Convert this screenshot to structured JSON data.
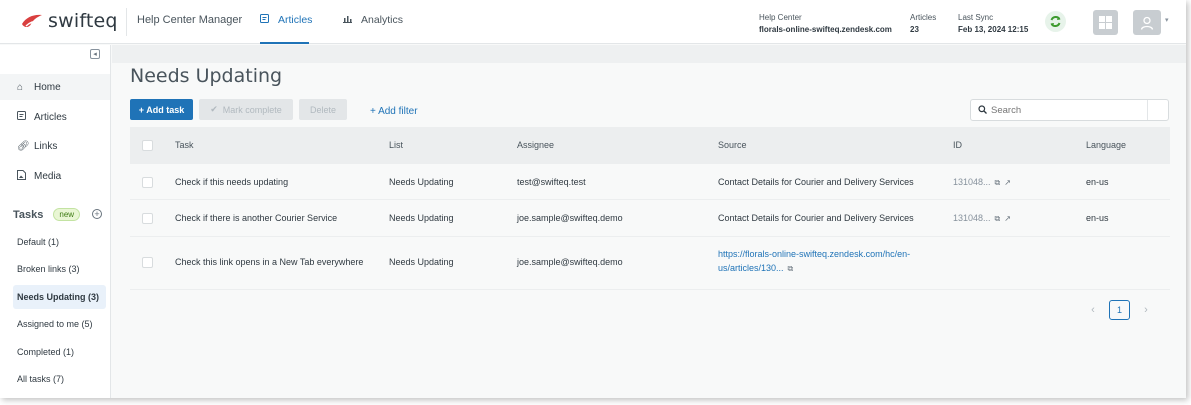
{
  "brand": {
    "name": "swifteq",
    "accent": "#1f73b7",
    "logo_color": "#d93f3f"
  },
  "header": {
    "app_title": "Help Center Manager",
    "tabs": [
      {
        "label": "Articles",
        "icon": "articles-icon",
        "active": true
      },
      {
        "label": "Analytics",
        "icon": "analytics-icon",
        "active": false
      }
    ],
    "help_center": {
      "label": "Help Center",
      "value": "florals-online-swifteq.zendesk.com"
    },
    "articles": {
      "label": "Articles",
      "value": "23"
    },
    "last_sync": {
      "label": "Last Sync",
      "value": "Feb 13, 2024 12:15"
    }
  },
  "sidebar": {
    "items": [
      {
        "label": "Home",
        "icon": "home-icon"
      },
      {
        "label": "Articles",
        "icon": "article-icon"
      },
      {
        "label": "Links",
        "icon": "link-icon"
      },
      {
        "label": "Media",
        "icon": "media-icon"
      }
    ],
    "tasks_title": "Tasks",
    "tasks_badge": "new",
    "task_lists": [
      {
        "label": "Default (1)",
        "active": false
      },
      {
        "label": "Broken links (3)",
        "active": false
      },
      {
        "label": "Needs Updating (3)",
        "active": true
      },
      {
        "label": "Assigned to me (5)",
        "active": false
      },
      {
        "label": "Completed (1)",
        "active": false
      },
      {
        "label": "All tasks (7)",
        "active": false
      }
    ]
  },
  "main": {
    "title": "Needs Updating",
    "toolbar": {
      "add_task": "+ Add task",
      "mark_complete": "Mark complete",
      "delete": "Delete",
      "add_filter": "+ Add filter"
    },
    "search": {
      "placeholder": "Search"
    },
    "columns": [
      "Task",
      "List",
      "Assignee",
      "Source",
      "ID",
      "Language"
    ],
    "rows": [
      {
        "task": "Check if this needs updating",
        "list": "Needs Updating",
        "assignee": "test@swifteq.test",
        "source": "Contact Details for Courier and Delivery Services",
        "id": "131048...",
        "language": "en-us"
      },
      {
        "task": "Check if there is another Courier Service",
        "list": "Needs Updating",
        "assignee": "joe.sample@swifteq.demo",
        "source": "Contact Details for Courier and Delivery Services",
        "id": "131048...",
        "language": "en-us"
      },
      {
        "task": "Check this link opens in a New Tab everywhere",
        "list": "Needs Updating",
        "assignee": "joe.sample@swifteq.demo",
        "source_line1": "https://florals-online-swifteq.zendesk.com/hc/en-",
        "source_line2": "us/articles/130...",
        "id": "",
        "language": ""
      }
    ],
    "pagination": {
      "current": "1"
    }
  }
}
